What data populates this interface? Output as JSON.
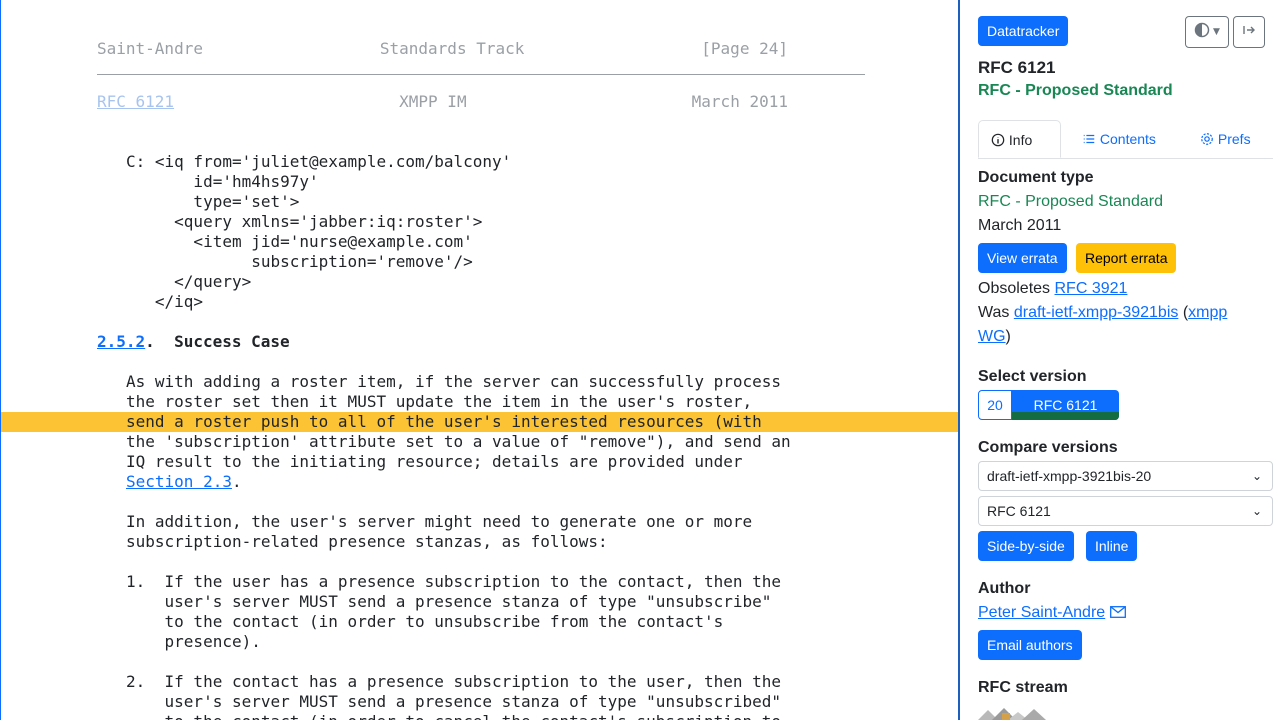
{
  "doc": {
    "footer": {
      "left": "Saint-Andre",
      "center": "Standards Track",
      "right": "[Page 24]"
    },
    "header": {
      "left": "RFC 6121",
      "center": "XMPP IM",
      "right": "March 2011"
    },
    "code_lines": [
      "C: <iq from='juliet@example.com/balcony'",
      "       id='hm4hs97y'",
      "       type='set'>",
      "     <query xmlns='jabber:iq:roster'>",
      "       <item jid='nurse@example.com'",
      "             subscription='remove'/>",
      "     </query>",
      "   </iq>"
    ],
    "section": {
      "number": "2.5.2",
      "title": "Success Case"
    },
    "para1": [
      "As with adding a roster item, if the server can successfully process",
      "the roster set then it MUST update the item in the user's roster,",
      "send a roster push to all of the user's interested resources (with",
      "the 'subscription' attribute set to a value of \"remove\"), and send an",
      "IQ result to the initiating resource; details are provided under"
    ],
    "para1_link": "Section 2.3",
    "para1_end": ".",
    "para2": [
      "In addition, the user's server might need to generate one or more",
      "subscription-related presence stanzas, as follows:"
    ],
    "list1": [
      "1.  If the user has a presence subscription to the contact, then the",
      "    user's server MUST send a presence stanza of type \"unsubscribe\"",
      "    to the contact (in order to unsubscribe from the contact's",
      "    presence)."
    ],
    "list2": [
      "2.  If the contact has a presence subscription to the user, then the",
      "    user's server MUST send a presence stanza of type \"unsubscribed\"",
      "    to the contact (in order to cancel the contact's subscription to"
    ]
  },
  "sidebar": {
    "datatracker_label": "Datatracker",
    "theme_icon": "half-circle-icon",
    "collapse_icon": "collapse-sidebar-icon",
    "rfc_title": "RFC 6121",
    "status": "RFC - Proposed Standard",
    "tabs": {
      "info": "Info",
      "contents": "Contents",
      "prefs": "Prefs"
    },
    "doc_type_heading": "Document type",
    "doc_type_value": "RFC - Proposed Standard",
    "date": "March 2011",
    "view_errata": "View errata",
    "report_errata": "Report errata",
    "obsoletes_prefix": "Obsoletes",
    "obsoletes_link": "RFC 3921",
    "was_prefix": "Was",
    "was_link": "draft-ietf-xmpp-3921bis",
    "was_paren_open": "(",
    "was_group_line1": "xmpp",
    "was_group_line2": "WG",
    "was_paren_close": ")",
    "select_version_heading": "Select version",
    "version_old": "20",
    "version_current": "RFC 6121",
    "compare_heading": "Compare versions",
    "compare_from": "draft-ietf-xmpp-3921bis-20",
    "compare_to": "RFC 6121",
    "side_by_side": "Side-by-side",
    "inline": "Inline",
    "author_heading": "Author",
    "author_name": "Peter Saint-Andre",
    "email_authors": "Email authors",
    "stream_heading": "RFC stream"
  },
  "colors": {
    "accent": "#0d6efd",
    "highlight": "#fcc434",
    "status_green": "#198754",
    "warning": "#ffc107"
  }
}
